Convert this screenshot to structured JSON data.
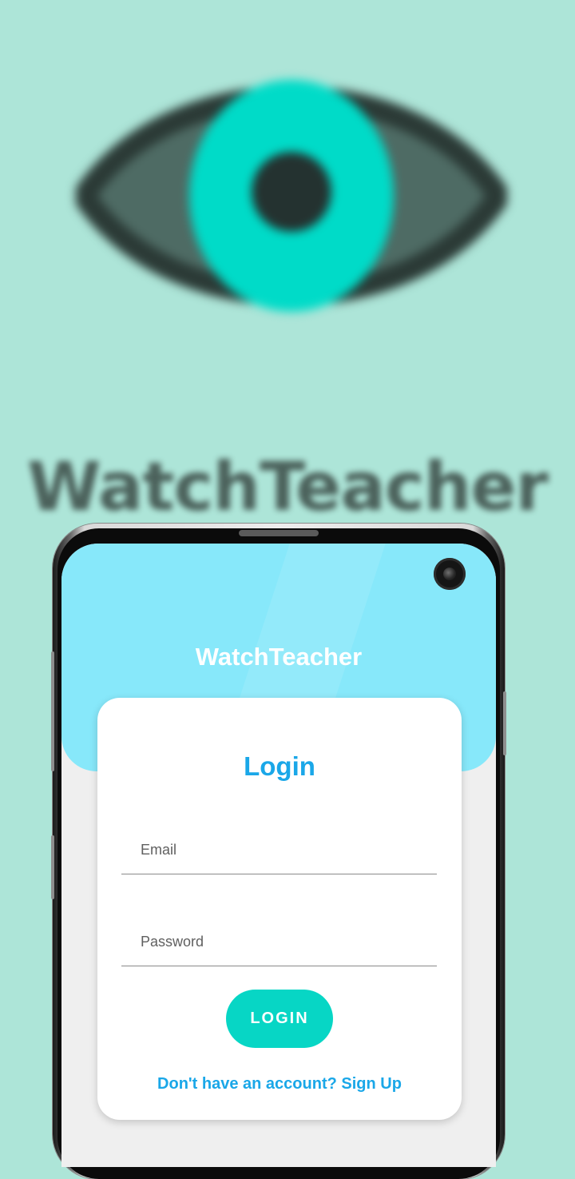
{
  "background": {
    "brand_text": "WatchTeacher",
    "logo_icon": "eye-icon",
    "colors": {
      "background": "#ade5d8",
      "eye_iris": "#00dbc8",
      "eye_outline": "#2b3a36"
    }
  },
  "app": {
    "title": "WatchTeacher",
    "header_color": "#87e8fa"
  },
  "login": {
    "heading": "Login",
    "email": {
      "value": "",
      "placeholder": "Email"
    },
    "password": {
      "value": "",
      "placeholder": "Password"
    },
    "button_label": "LOGIN",
    "signup_text": "Don't have an account? Sign Up",
    "accent_color": "#1aa7e8",
    "button_color": "#07d6c5"
  }
}
